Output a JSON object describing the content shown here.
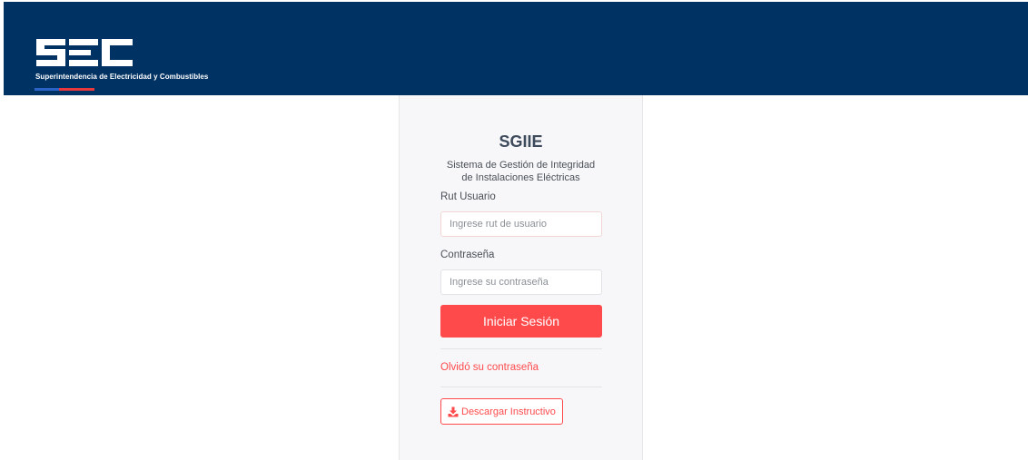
{
  "header": {
    "logo_text": "SEC",
    "logo_subtitle": "Superintendencia de Electricidad y Combustibles",
    "brand_bg": "#003264",
    "stripe_colors": [
      "#2a63c7",
      "#e8383d"
    ]
  },
  "login": {
    "app_title": "SGIIE",
    "app_subtitle_line1": "Sistema de Gestión de Integridad",
    "app_subtitle_line2": "de Instalaciones Eléctricas",
    "rut_label": "Rut Usuario",
    "rut_placeholder": "Ingrese rut de usuario",
    "rut_value": "",
    "password_label": "Contraseña",
    "password_placeholder": "Ingrese su contraseña",
    "password_value": "",
    "submit_label": "Iniciar Sesión",
    "forgot_label": "Olvidó su contraseña",
    "download_label": "Descargar Instructivo",
    "download_icon": "download-icon",
    "accent_color": "#ff4a4c"
  }
}
